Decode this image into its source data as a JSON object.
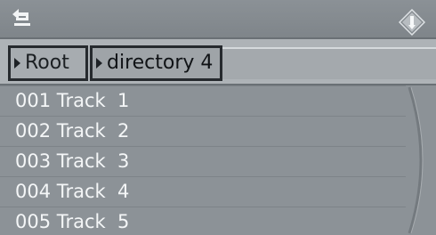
{
  "breadcrumb": {
    "root_label": "Root",
    "current_label": "directory 4"
  },
  "tracks": [
    {
      "label": "001 Track  1"
    },
    {
      "label": "002 Track  2"
    },
    {
      "label": "003 Track  3"
    },
    {
      "label": "004 Track  4"
    },
    {
      "label": "005 Track  5"
    }
  ],
  "icons": {
    "back": "back-arrow-icon",
    "navigation": "nav-controller-icon"
  },
  "colors": {
    "background": "#8e9499",
    "breadcrumb_strip": "#aeb3b7",
    "text_light": "#f4f6f7",
    "text_dark": "#101316"
  }
}
